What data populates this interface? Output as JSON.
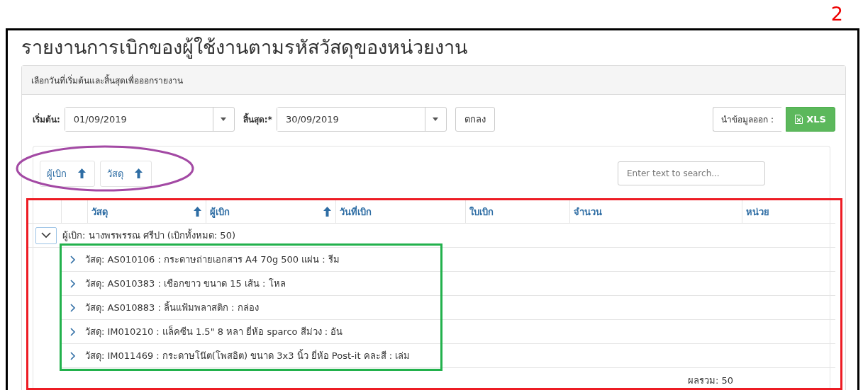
{
  "page_number": "2",
  "title": "รายงานการเบิกของผู้ใช้งานตามรหัสวัสดุของหน่วยงาน",
  "panel": {
    "header": "เลือกวันที่เริ่มต้นและสิ้นสุดเพื่อออกรายงาน",
    "start": {
      "label": "เริ่มต้น:",
      "value": "01/09/2019"
    },
    "end": {
      "label": "สิ้นสุด:*",
      "value": "30/09/2019"
    },
    "ok_button": "ตกลง",
    "export": {
      "label": "นำข้อมูลออก :",
      "button": "XLS"
    }
  },
  "grid": {
    "group_panel": [
      {
        "label": "ผู้เบิก",
        "sorted_ascending": true
      },
      {
        "label": "วัสดุ",
        "sorted_ascending": true
      }
    ],
    "search": {
      "placeholder": "Enter text to search..."
    },
    "columns": [
      {
        "label": "วัสดุ",
        "sorted_ascending": true
      },
      {
        "label": "ผู้เบิก",
        "sorted_ascending": true
      },
      {
        "label": "วันที่เบิก"
      },
      {
        "label": "ใบเบิก"
      },
      {
        "label": "จำนวน"
      },
      {
        "label": "หน่วย"
      }
    ],
    "groups": [
      {
        "label": "ผู้เบิก: นางพรพรรณ ศรีปา (เบิกทั้งหมด: 50)",
        "expanded": true,
        "children": [
          {
            "label": "วัสดุ: AS010106 : กระดาษถ่ายเอกสาร A4 70g 500 แผ่น : รีม",
            "expanded": false
          },
          {
            "label": "วัสดุ: AS010383 : เชือกขาว ขนาด 15 เส้น : โหล",
            "expanded": false
          },
          {
            "label": "วัสดุ: AS010883 : ลิ้นแฟ้มพลาสติก : กล่อง",
            "expanded": false
          },
          {
            "label": "วัสดุ: IM010210 : แล็คซีน 1.5\" 8 หลา ยี่ห้อ sparco สีม่วง : อัน",
            "expanded": false
          },
          {
            "label": "วัสดุ: IM011469 : กระดาษโน๊ต(โพสอิต) ขนาด 3x3 นิ้ว ยี่ห้อ Post-it คละสี : เล่ม",
            "expanded": false
          }
        ]
      }
    ],
    "total": "ผลรวม: 50"
  },
  "annotations": [
    {
      "kind": "ellipse",
      "color": "#a349a4"
    },
    {
      "kind": "rectangle",
      "color": "#ed1c24"
    },
    {
      "kind": "rectangle",
      "color": "#22b14c"
    }
  ]
}
